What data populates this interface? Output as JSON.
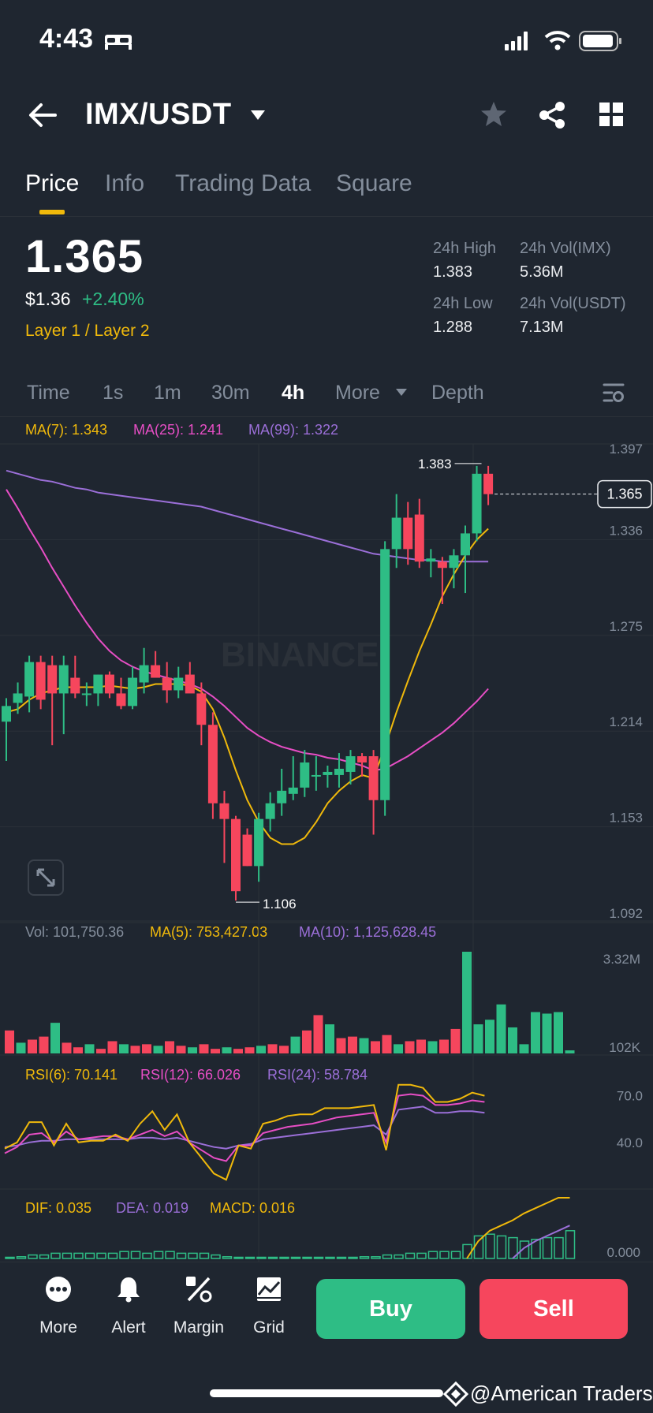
{
  "status_bar": {
    "time": "4:43"
  },
  "header": {
    "pair": "IMX/USDT"
  },
  "tabs": [
    {
      "label": "Price",
      "active": true
    },
    {
      "label": "Info"
    },
    {
      "label": "Trading Data"
    },
    {
      "label": "Square"
    }
  ],
  "price": {
    "last": "1.365",
    "fiat": "$1.36",
    "change": "+2.40%",
    "tags": "Layer 1 / Layer 2"
  },
  "stats": {
    "high_label": "24h High",
    "high": "1.383",
    "vol_base_label": "24h Vol(IMX)",
    "vol_base": "5.36M",
    "low_label": "24h Low",
    "low": "1.288",
    "vol_quote_label": "24h Vol(USDT)",
    "vol_quote": "7.13M"
  },
  "timeframes": [
    "Time",
    "1s",
    "1m",
    "30m",
    "4h",
    "More",
    "Depth"
  ],
  "active_timeframe": "4h",
  "main_legend": {
    "ma7": "MA(7): 1.343",
    "ma25": "MA(25): 1.241",
    "ma99": "MA(99): 1.322"
  },
  "vol_legend": {
    "vol": "Vol: 101,750.36",
    "ma5": "MA(5): 753,427.03",
    "ma10": "MA(10): 1,125,628.45"
  },
  "rsi_legend": {
    "rsi6": "RSI(6): 70.141",
    "rsi12": "RSI(12): 66.026",
    "rsi24": "RSI(24): 58.784"
  },
  "macd_legend": {
    "dif": "DIF: 0.035",
    "dea": "DEA: 0.019",
    "macd": "MACD: 0.016"
  },
  "watermark_chart": "BINANCE",
  "bottom_nav": [
    {
      "label": "More",
      "icon": "more-dots-icon"
    },
    {
      "label": "Alert",
      "icon": "bell-icon"
    },
    {
      "label": "Margin",
      "icon": "percent-icon"
    },
    {
      "label": "Grid",
      "icon": "grid-chart-icon"
    }
  ],
  "buttons": {
    "buy": "Buy",
    "sell": "Sell"
  },
  "footer_watermark": "@American Traders",
  "colors": {
    "up": "#2ebd85",
    "down": "#f6465d",
    "accent": "#f0b90b",
    "bg": "#1f2630"
  },
  "chart_data": {
    "type": "candlestick",
    "interval": "4h",
    "price_axis_ticks": [
      "1.397",
      "1.336",
      "1.275",
      "1.214",
      "1.153",
      "1.092"
    ],
    "price_ylim": [
      1.092,
      1.397
    ],
    "current_price_label": "1.365",
    "high_marker": "1.383",
    "low_marker": "1.106",
    "candles": [
      {
        "o": 1.22,
        "h": 1.235,
        "l": 1.195,
        "c": 1.23
      },
      {
        "o": 1.232,
        "h": 1.245,
        "l": 1.225,
        "c": 1.238
      },
      {
        "o": 1.236,
        "h": 1.262,
        "l": 1.226,
        "c": 1.258
      },
      {
        "o": 1.258,
        "h": 1.262,
        "l": 1.228,
        "c": 1.234
      },
      {
        "o": 1.256,
        "h": 1.262,
        "l": 1.205,
        "c": 1.238
      },
      {
        "o": 1.238,
        "h": 1.262,
        "l": 1.212,
        "c": 1.256
      },
      {
        "o": 1.248,
        "h": 1.262,
        "l": 1.235,
        "c": 1.238
      },
      {
        "o": 1.238,
        "h": 1.245,
        "l": 1.23,
        "c": 1.238
      },
      {
        "o": 1.238,
        "h": 1.25,
        "l": 1.23,
        "c": 1.25
      },
      {
        "o": 1.25,
        "h": 1.252,
        "l": 1.235,
        "c": 1.238
      },
      {
        "o": 1.238,
        "h": 1.248,
        "l": 1.228,
        "c": 1.23
      },
      {
        "o": 1.23,
        "h": 1.255,
        "l": 1.228,
        "c": 1.248
      },
      {
        "o": 1.245,
        "h": 1.267,
        "l": 1.238,
        "c": 1.256
      },
      {
        "o": 1.256,
        "h": 1.265,
        "l": 1.25,
        "c": 1.248
      },
      {
        "o": 1.248,
        "h": 1.258,
        "l": 1.232,
        "c": 1.24
      },
      {
        "o": 1.24,
        "h": 1.255,
        "l": 1.235,
        "c": 1.248
      },
      {
        "o": 1.25,
        "h": 1.258,
        "l": 1.24,
        "c": 1.238
      },
      {
        "o": 1.238,
        "h": 1.245,
        "l": 1.205,
        "c": 1.218
      },
      {
        "o": 1.218,
        "h": 1.226,
        "l": 1.158,
        "c": 1.168
      },
      {
        "o": 1.168,
        "h": 1.176,
        "l": 1.13,
        "c": 1.158
      },
      {
        "o": 1.158,
        "h": 1.16,
        "l": 1.106,
        "c": 1.112
      },
      {
        "o": 1.148,
        "h": 1.152,
        "l": 1.128,
        "c": 1.128
      },
      {
        "o": 1.128,
        "h": 1.162,
        "l": 1.118,
        "c": 1.158
      },
      {
        "o": 1.158,
        "h": 1.175,
        "l": 1.15,
        "c": 1.168
      },
      {
        "o": 1.168,
        "h": 1.19,
        "l": 1.16,
        "c": 1.176
      },
      {
        "o": 1.174,
        "h": 1.198,
        "l": 1.17,
        "c": 1.178
      },
      {
        "o": 1.178,
        "h": 1.202,
        "l": 1.172,
        "c": 1.194
      },
      {
        "o": 1.186,
        "h": 1.198,
        "l": 1.176,
        "c": 1.186
      },
      {
        "o": 1.186,
        "h": 1.192,
        "l": 1.178,
        "c": 1.188
      },
      {
        "o": 1.186,
        "h": 1.2,
        "l": 1.178,
        "c": 1.19
      },
      {
        "o": 1.188,
        "h": 1.202,
        "l": 1.18,
        "c": 1.198
      },
      {
        "o": 1.198,
        "h": 1.2,
        "l": 1.185,
        "c": 1.194
      },
      {
        "o": 1.198,
        "h": 1.202,
        "l": 1.148,
        "c": 1.17
      },
      {
        "o": 1.17,
        "h": 1.335,
        "l": 1.16,
        "c": 1.33
      },
      {
        "o": 1.33,
        "h": 1.365,
        "l": 1.318,
        "c": 1.35
      },
      {
        "o": 1.35,
        "h": 1.36,
        "l": 1.32,
        "c": 1.33
      },
      {
        "o": 1.352,
        "h": 1.362,
        "l": 1.318,
        "c": 1.322
      },
      {
        "o": 1.322,
        "h": 1.33,
        "l": 1.312,
        "c": 1.324
      },
      {
        "o": 1.322,
        "h": 1.325,
        "l": 1.295,
        "c": 1.318
      },
      {
        "o": 1.318,
        "h": 1.33,
        "l": 1.305,
        "c": 1.326
      },
      {
        "o": 1.326,
        "h": 1.345,
        "l": 1.302,
        "c": 1.34
      },
      {
        "o": 1.34,
        "h": 1.383,
        "l": 1.335,
        "c": 1.378
      },
      {
        "o": 1.378,
        "h": 1.383,
        "l": 1.358,
        "c": 1.365
      }
    ],
    "ma7": [
      1.226,
      1.228,
      1.234,
      1.238,
      1.24,
      1.242,
      1.242,
      1.242,
      1.242,
      1.243,
      1.242,
      1.241,
      1.242,
      1.244,
      1.244,
      1.244,
      1.243,
      1.239,
      1.228,
      1.21,
      1.189,
      1.17,
      1.156,
      1.146,
      1.142,
      1.142,
      1.146,
      1.156,
      1.168,
      1.176,
      1.182,
      1.186,
      1.184,
      1.204,
      1.226,
      1.246,
      1.265,
      1.282,
      1.3,
      1.314,
      1.326,
      1.336,
      1.343
    ],
    "ma25": [
      1.368,
      1.356,
      1.343,
      1.331,
      1.318,
      1.306,
      1.294,
      1.283,
      1.273,
      1.265,
      1.259,
      1.255,
      1.252,
      1.25,
      1.248,
      1.246,
      1.244,
      1.241,
      1.236,
      1.23,
      1.223,
      1.216,
      1.211,
      1.207,
      1.204,
      1.202,
      1.2,
      1.199,
      1.197,
      1.196,
      1.194,
      1.192,
      1.189,
      1.19,
      1.194,
      1.198,
      1.203,
      1.208,
      1.213,
      1.219,
      1.226,
      1.233,
      1.241
    ],
    "ma99": [
      1.38,
      1.378,
      1.376,
      1.374,
      1.373,
      1.371,
      1.369,
      1.368,
      1.366,
      1.365,
      1.364,
      1.363,
      1.362,
      1.361,
      1.36,
      1.359,
      1.358,
      1.357,
      1.355,
      1.353,
      1.351,
      1.349,
      1.347,
      1.345,
      1.343,
      1.341,
      1.339,
      1.337,
      1.335,
      1.333,
      1.331,
      1.329,
      1.327,
      1.326,
      1.325,
      1.324,
      1.323,
      1.323,
      1.322,
      1.322,
      1.322,
      1.322,
      1.322
    ],
    "volume_axis_ticks": [
      "3.32M",
      "102K"
    ],
    "volume_ylim": [
      0,
      3.5
    ],
    "volume_millions": [
      0.75,
      0.35,
      0.45,
      0.55,
      1.0,
      0.35,
      0.2,
      0.3,
      0.15,
      0.4,
      0.3,
      0.25,
      0.3,
      0.25,
      0.4,
      0.25,
      0.2,
      0.3,
      0.15,
      0.2,
      0.15,
      0.2,
      0.25,
      0.3,
      0.25,
      0.55,
      0.75,
      1.25,
      0.95,
      0.5,
      0.55,
      0.5,
      0.4,
      0.6,
      0.3,
      0.4,
      0.45,
      0.4,
      0.45,
      0.8,
      3.32,
      0.95,
      1.1,
      1.6,
      0.85,
      0.3,
      1.35,
      1.3,
      1.35,
      0.1
    ],
    "rsi_axis_ticks": [
      "70.0",
      "40.0"
    ],
    "rsi_ylim": [
      10,
      85
    ],
    "rsi6": [
      36,
      40,
      53,
      53,
      38,
      52,
      40,
      41,
      41,
      45,
      41,
      52,
      60,
      48,
      58,
      40,
      30,
      20,
      16,
      38,
      36,
      52,
      54,
      57,
      58,
      58,
      62,
      62,
      62,
      63,
      64,
      35,
      77,
      77,
      75,
      66,
      66,
      68,
      72,
      70
    ],
    "rsi12": [
      33,
      37,
      45,
      46,
      40,
      47,
      42,
      43,
      44,
      44,
      42,
      45,
      48,
      44,
      47,
      40,
      35,
      30,
      28,
      38,
      38,
      46,
      48,
      50,
      51,
      52,
      54,
      56,
      57,
      58,
      59,
      40,
      70,
      71,
      70,
      64,
      64,
      65,
      67,
      66
    ],
    "rsi24": [
      37,
      38,
      40,
      41,
      41,
      42,
      42,
      42,
      42,
      42,
      42,
      43,
      43,
      42,
      43,
      41,
      39,
      37,
      36,
      38,
      39,
      42,
      43,
      44,
      45,
      46,
      47,
      48,
      49,
      50,
      51,
      45,
      61,
      62,
      63,
      59,
      59,
      60,
      60,
      59
    ],
    "macd_axis_ticks": [
      "0.000"
    ],
    "macd_hist": [
      0.0,
      0.001,
      0.002,
      0.002,
      0.003,
      0.003,
      0.003,
      0.003,
      0.003,
      0.003,
      0.004,
      0.004,
      0.003,
      0.004,
      0.004,
      0.003,
      0.003,
      0.003,
      0.002,
      0.001,
      0.0,
      0.0,
      0.0,
      0.0,
      0.0,
      0.0,
      0.0,
      0.0,
      0.0,
      0.0,
      0.0,
      0.001,
      0.001,
      0.002,
      0.002,
      0.003,
      0.003,
      0.004,
      0.004,
      0.004,
      0.008,
      0.013,
      0.014,
      0.013,
      0.012,
      0.01,
      0.011,
      0.012,
      0.012,
      0.016
    ],
    "dif": [
      null,
      null,
      null,
      null,
      null,
      null,
      null,
      null,
      null,
      null,
      null,
      null,
      null,
      null,
      null,
      null,
      null,
      null,
      null,
      null,
      null,
      null,
      null,
      null,
      null,
      null,
      null,
      null,
      null,
      null,
      null,
      null,
      null,
      null,
      null,
      null,
      null,
      null,
      null,
      null,
      0.0,
      0.01,
      0.016,
      0.019,
      0.022,
      0.026,
      0.029,
      0.032,
      0.035,
      0.035
    ],
    "dea": [
      null,
      null,
      null,
      null,
      null,
      null,
      null,
      null,
      null,
      null,
      null,
      null,
      null,
      null,
      null,
      null,
      null,
      null,
      null,
      null,
      null,
      null,
      null,
      null,
      null,
      null,
      null,
      null,
      null,
      null,
      null,
      null,
      null,
      null,
      null,
      null,
      null,
      null,
      null,
      null,
      null,
      null,
      null,
      null,
      0.0,
      0.006,
      0.01,
      0.013,
      0.016,
      0.019
    ]
  }
}
